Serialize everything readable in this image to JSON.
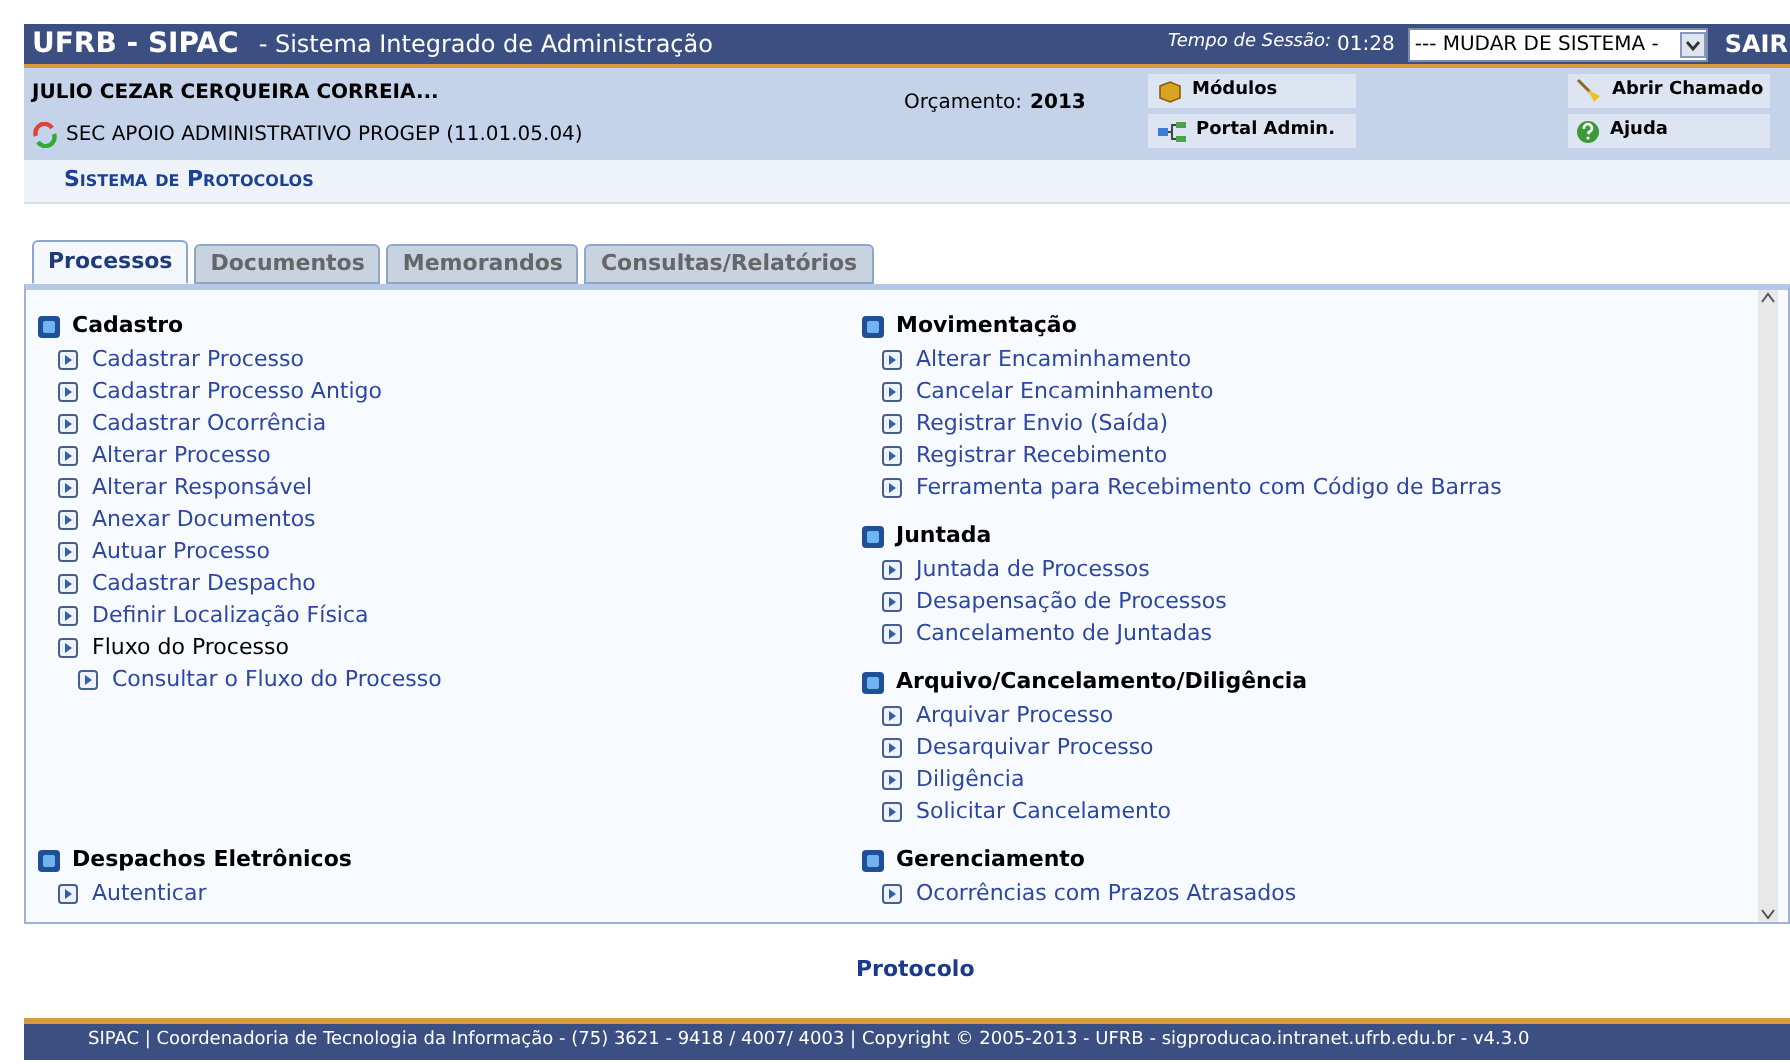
{
  "header": {
    "brand": "UFRB - SIPAC",
    "subtitle": "- Sistema Integrado de Administração",
    "session_label": "Tempo de Sessão:",
    "session_time": "01:28",
    "system_select": {
      "value": "--- MUDAR DE SISTEMA -"
    },
    "logout": "SAIR"
  },
  "user_info": {
    "name": "JULIO CEZAR CERQUEIRA CORREIA...",
    "unit": "SEC APOIO ADMINISTRATIVO PROGEP (11.01.05.04)",
    "budget_label": "Orçamento:",
    "budget_year": "2013"
  },
  "shortcuts": [
    {
      "label": "Módulos",
      "kind": "modules"
    },
    {
      "label": "Portal Admin.",
      "kind": "portal"
    }
  ],
  "help_links": [
    {
      "label": "Abrir Chamado",
      "kind": "ticket"
    },
    {
      "label": "Ajuda",
      "kind": "help"
    }
  ],
  "module_title": "Sistema de Protocolos",
  "tabs": [
    {
      "label": "Processos",
      "selected": true
    },
    {
      "label": "Documentos",
      "selected": false
    },
    {
      "label": "Memorandos",
      "selected": false
    },
    {
      "label": "Consultas/Relatórios",
      "selected": false
    }
  ],
  "menu_rows": [
    {
      "left": [
        {
          "title": "Cadastro",
          "items": [
            {
              "label": "Cadastrar Processo"
            },
            {
              "label": "Cadastrar Processo Antigo"
            },
            {
              "label": "Cadastrar Ocorrência"
            },
            {
              "label": "Alterar Processo"
            },
            {
              "label": "Alterar Responsável"
            },
            {
              "label": "Anexar Documentos"
            },
            {
              "label": "Autuar Processo"
            },
            {
              "label": "Cadastrar Despacho"
            },
            {
              "label": "Definir Localização Física"
            },
            {
              "label": "Fluxo do Processo",
              "children": [
                {
                  "label": "Consultar o Fluxo do Processo"
                }
              ]
            }
          ]
        }
      ],
      "right": [
        {
          "title": "Movimentação",
          "items": [
            {
              "label": "Alterar Encaminhamento"
            },
            {
              "label": "Cancelar Encaminhamento"
            },
            {
              "label": "Registrar Envio (Saída)"
            },
            {
              "label": "Registrar Recebimento"
            },
            {
              "label": "Ferramenta para Recebimento com Código de Barras"
            }
          ]
        },
        {
          "title": "Juntada",
          "items": [
            {
              "label": "Juntada de Processos"
            },
            {
              "label": "Desapensação de Processos"
            },
            {
              "label": "Cancelamento de Juntadas"
            }
          ]
        },
        {
          "title": "Arquivo/Cancelamento/Diligência",
          "items": [
            {
              "label": "Arquivar Processo"
            },
            {
              "label": "Desarquivar Processo"
            },
            {
              "label": "Diligência"
            },
            {
              "label": "Solicitar Cancelamento"
            }
          ]
        }
      ]
    },
    {
      "left": [
        {
          "title": "Despachos Eletrônicos",
          "items": [
            {
              "label": "Autenticar"
            }
          ]
        }
      ],
      "right": [
        {
          "title": "Gerenciamento",
          "items": [
            {
              "label": "Ocorrências com Prazos Atrasados"
            }
          ]
        }
      ]
    }
  ],
  "footer_link": "Protocolo",
  "footer": "SIPAC | Coordenadoria de Tecnologia da Informação - (75) 3621 - 9418 / 4007/ 4003 | Copyright © 2005-2013 - UFRB - sigproducao.intranet.ufrb.edu.br - v4.3.0"
}
